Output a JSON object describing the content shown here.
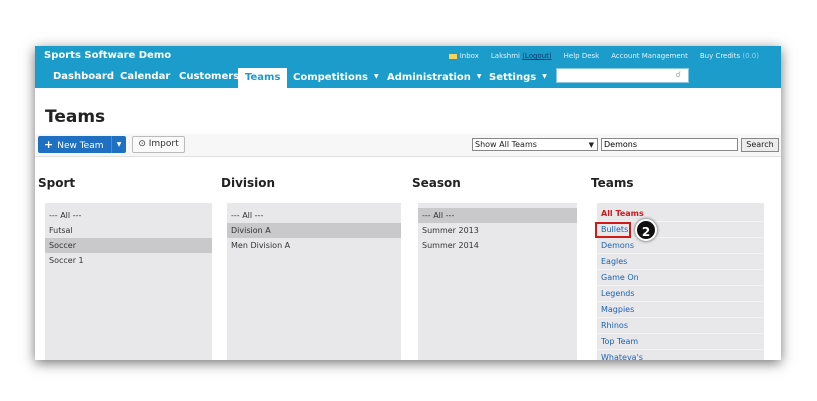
{
  "app": {
    "title": "Sports Software Demo"
  },
  "toplinks": {
    "inbox": "Inbox",
    "user": "Lakshmi",
    "logout": "(Logout)",
    "help": "Help Desk",
    "account": "Account Management",
    "credits": "Buy Credits",
    "credit_count": "(0.0)"
  },
  "nav": {
    "items": [
      "Dashboard",
      "Calendar",
      "Customers",
      "Teams",
      "Competitions",
      "Administration",
      "Settings"
    ],
    "active": "Teams",
    "arrow": "▼",
    "search_placeholder": ""
  },
  "page": {
    "title": "Teams"
  },
  "toolbar": {
    "new_team": "New Team",
    "plus": "+",
    "caret": "▼",
    "import": "Import",
    "import_icon": "⊙",
    "show_filter": "Show All Teams",
    "dd_arrow": "▼",
    "search_value": "Demons",
    "search_button": "Search"
  },
  "columns": {
    "sport": {
      "heading": "Sport",
      "items": [
        "--- All ---",
        "Futsal",
        "Soccer",
        "Soccer 1"
      ],
      "selected": "Soccer"
    },
    "division": {
      "heading": "Division",
      "items": [
        "--- All ---",
        "Division A",
        "Men Division A"
      ],
      "selected": "Division A"
    },
    "season": {
      "heading": "Season",
      "items": [
        "--- All ---",
        "Summer 2013",
        "Summer 2014"
      ],
      "selected": "--- All ---"
    },
    "teams": {
      "heading": "Teams",
      "items": [
        "All Teams",
        "Bullets",
        "Demons",
        "Eagles",
        "Game On",
        "Legends",
        "Magpies",
        "Rhinos",
        "Top Team",
        "Whateva's"
      ]
    }
  },
  "annotation": {
    "step": "2"
  },
  "colors": {
    "brand": "#1c9ccb",
    "primary_button": "#1f6fc2",
    "link": "#1b62b5",
    "highlight": "#d11a1a"
  }
}
